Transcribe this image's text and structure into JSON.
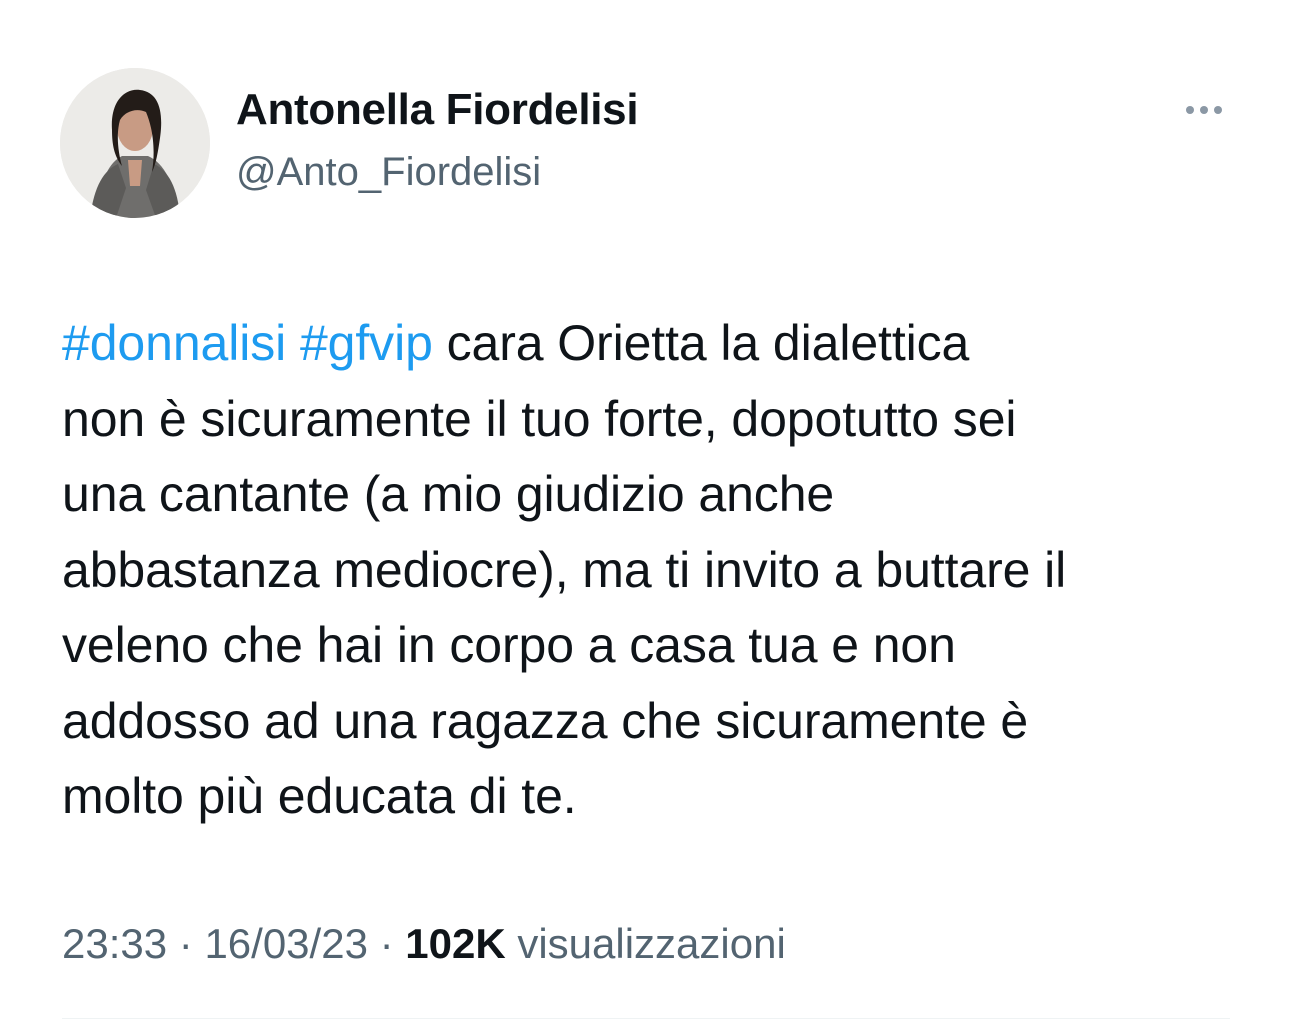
{
  "tweet": {
    "author": {
      "display_name": "Antonella Fiordelisi",
      "handle": "@Anto_Fiordelisi",
      "avatar_icon": "profile-photo"
    },
    "more_icon": "more-horizontal-icon",
    "text_lines": [
      [
        {
          "text": "#donnalisi",
          "hashtag": true
        },
        {
          "text": " ",
          "hashtag": false
        },
        {
          "text": "#gfvip",
          "hashtag": true
        },
        {
          "text": " cara Orietta la dialettica",
          "hashtag": false
        }
      ],
      [
        {
          "text": "non è sicuramente il tuo forte, dopotutto sei",
          "hashtag": false
        }
      ],
      [
        {
          "text": "una cantante (a mio giudizio anche",
          "hashtag": false
        }
      ],
      [
        {
          "text": "abbastanza mediocre), ma ti invito a buttare il",
          "hashtag": false
        }
      ],
      [
        {
          "text": "veleno che hai in corpo a casa tua e non",
          "hashtag": false
        }
      ],
      [
        {
          "text": "addosso ad una ragazza che sicuramente è",
          "hashtag": false
        }
      ],
      [
        {
          "text": "molto più educata di te.",
          "hashtag": false
        }
      ]
    ],
    "time": "23:33",
    "separator": " · ",
    "date": "16/03/23",
    "views_count": "102K",
    "views_label": " visualizzazioni"
  },
  "colors": {
    "text": "#0f1419",
    "secondary": "#536471",
    "hashtag": "#1d9bf0",
    "divider": "#eff3f4"
  }
}
